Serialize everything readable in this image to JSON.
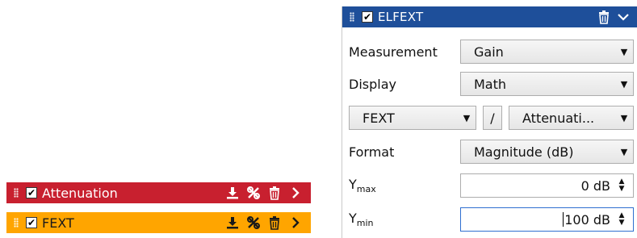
{
  "traces": [
    {
      "label": "Attenuation",
      "checked": true,
      "color": "#c8202f"
    },
    {
      "label": "FEXT",
      "checked": true,
      "color": "#ffa500"
    }
  ],
  "panel": {
    "title": "ELFEXT",
    "checked": true,
    "header_color": "#1e4f9a",
    "measurement": {
      "label": "Measurement",
      "value": "Gain"
    },
    "display": {
      "label": "Display",
      "value": "Math"
    },
    "math": {
      "left": "FEXT",
      "operator": "/",
      "right": "Attenuati..."
    },
    "format": {
      "label": "Format",
      "value": "Magnitude (dB)"
    },
    "ymax": {
      "label_main": "Y",
      "label_sub": "max",
      "value": "0 dB"
    },
    "ymin": {
      "label_main": "Y",
      "label_sub": "min",
      "value": "100 dB"
    }
  },
  "icons": {
    "grip": "drag-grip-icon",
    "checkbox": "checkbox-icon",
    "download": "download-icon",
    "unlink": "unlink-icon",
    "trash": "trash-icon",
    "chevron_right": "chevron-right-icon",
    "chevron_down": "chevron-down-icon",
    "caret": "caret-down-icon",
    "spinner": "spinner-icon"
  }
}
